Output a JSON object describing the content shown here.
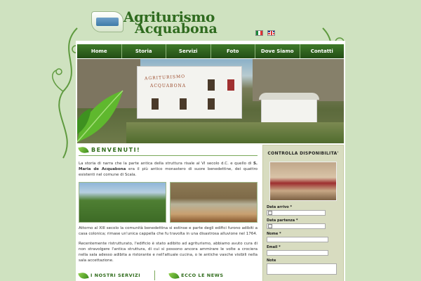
{
  "logo": {
    "line1": "Agriturismo",
    "line2": "Acquabona"
  },
  "nav": [
    "Home",
    "Storia",
    "Servizi",
    "Foto",
    "Dove Siamo",
    "Contatti"
  ],
  "hero": {
    "sign_line1": "AGRITURISMO",
    "sign_line2": "ACQUABONA"
  },
  "welcome": {
    "title": "BENVENUTI!",
    "p1_a": "La storia di narra che la parte antica della struttura risale al VI secolo d.C. e quello di ",
    "p1_bold": "S. Maria de Acquabona",
    "p1_b": " era il più antico monastero di suore benedettine, dei quattro esistenti nel comune di Scala.",
    "p2": "Attorno al XIII secolo la comunità benedettina si estinse e parte degli edifici furono adibiti a casa colonica; rimase un'unica cappella che fu travolta in una disastrosa alluvione nel 1764.",
    "p3": "Recentemente ristrutturato, l'edificio è stato adibito ad agriturismo, abbiamo avuto cura di non stravolgere l'antica struttura, di cui si possono ancora ammirare le volte a crociera nella sala adesso adibita a ristorante e nell'attuale cucina, o le antiche vasche visibili nella sala accettazione."
  },
  "bottom": {
    "services": "I NOSTRI SERVIZI",
    "news": "ECCO LE NEWS"
  },
  "sidebar": {
    "title": "CONTROLLA DISPONIBILITA'",
    "fields": {
      "arrival": "Data arrivo *",
      "departure": "Data partenza *",
      "name": "Nome *",
      "email": "Email *",
      "notes": "Note"
    }
  },
  "colors": {
    "accent": "#2e6b1a",
    "nav": "#2d5e1c",
    "background": "#cfe2c0"
  }
}
